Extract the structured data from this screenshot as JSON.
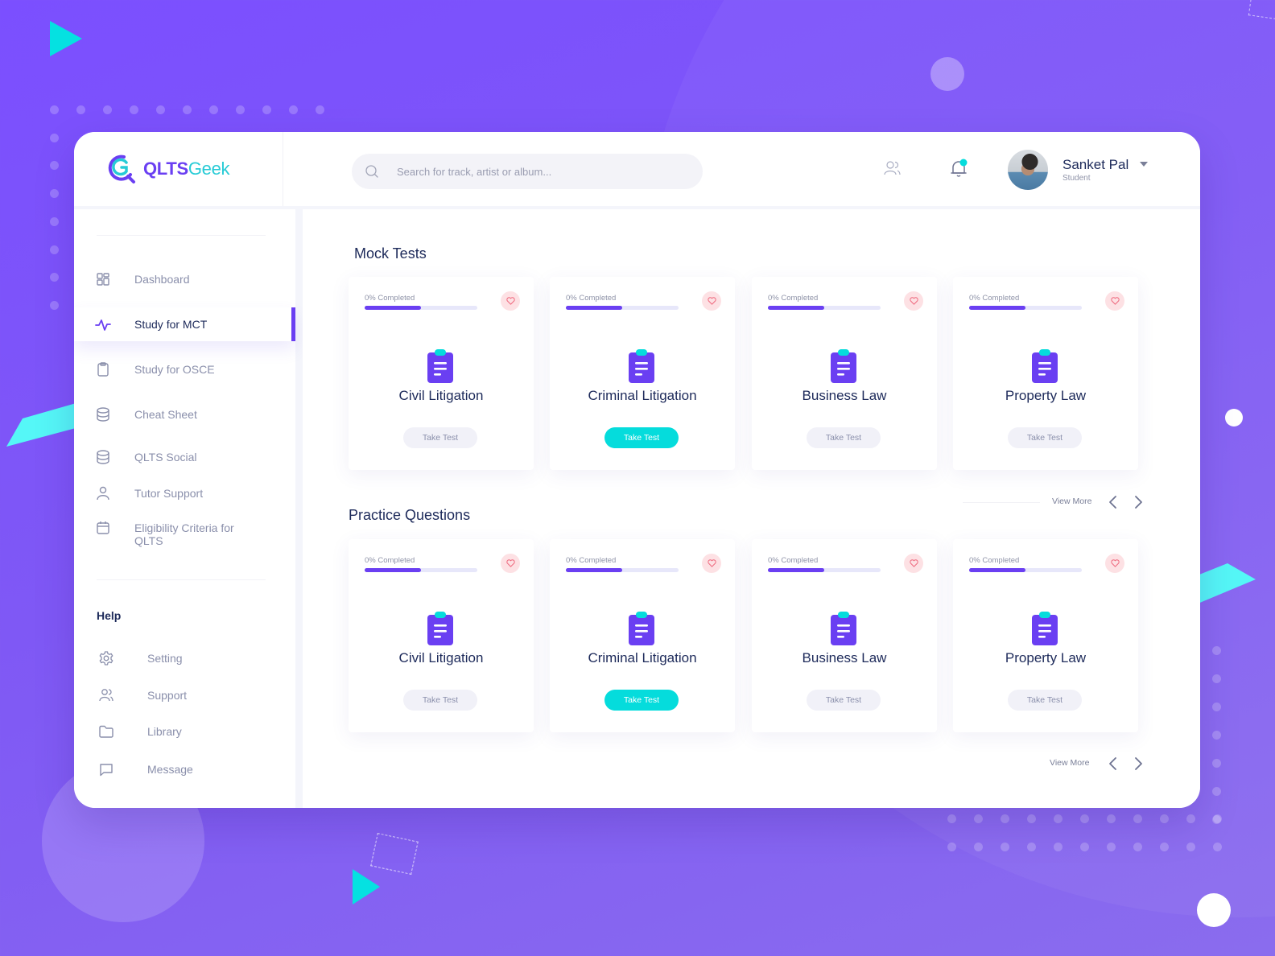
{
  "app": {
    "logo_q": "QLTS",
    "logo_g": "Geek"
  },
  "search": {
    "placeholder": "Search for track, artist or album..."
  },
  "user": {
    "name": "Sanket Pal",
    "role": "Student",
    "notification_dot_color": "#05dcdc"
  },
  "sidebar": {
    "items": [
      {
        "label": "Dashboard",
        "icon": "grid-icon"
      },
      {
        "label": "Study for MCT",
        "icon": "activity-icon",
        "active": true
      },
      {
        "label": "Study for OSCE",
        "icon": "clipboard-icon"
      },
      {
        "label": "Cheat Sheet",
        "icon": "database-icon"
      },
      {
        "label": "QLTS Social",
        "icon": "database-icon"
      },
      {
        "label": "Tutor Support",
        "icon": "user-icon"
      },
      {
        "label": "Eligibility Criteria for QLTS",
        "icon": "calendar-icon"
      }
    ],
    "help_title": "Help",
    "help_items": [
      {
        "label": "Setting",
        "icon": "gear-icon"
      },
      {
        "label": "Support",
        "icon": "users-icon"
      },
      {
        "label": "Library",
        "icon": "folder-icon"
      },
      {
        "label": "Message",
        "icon": "message-icon"
      }
    ]
  },
  "mock_tests": {
    "title": "Mock Tests",
    "cards": [
      {
        "name": "Civil Litigation",
        "progress_label": "0% Completed",
        "progress_bar": 0.5,
        "button": "Take Test",
        "highlight": false
      },
      {
        "name": "Criminal Litigation",
        "progress_label": "0% Completed",
        "progress_bar": 0.5,
        "button": "Take Test",
        "highlight": true
      },
      {
        "name": "Business Law",
        "progress_label": "0% Completed",
        "progress_bar": 0.5,
        "button": "Take Test",
        "highlight": false
      },
      {
        "name": "Property Law",
        "progress_label": "0% Completed",
        "progress_bar": 0.5,
        "button": "Take Test",
        "highlight": false
      }
    ],
    "view_more": "View More"
  },
  "practice_questions": {
    "title": "Practice Questions",
    "cards": [
      {
        "name": "Civil Litigation",
        "progress_label": "0% Completed",
        "progress_bar": 0.5,
        "button": "Take Test",
        "highlight": false
      },
      {
        "name": "Criminal Litigation",
        "progress_label": "0% Completed",
        "progress_bar": 0.5,
        "button": "Take Test",
        "highlight": true
      },
      {
        "name": "Business Law",
        "progress_label": "0% Completed",
        "progress_bar": 0.5,
        "button": "Take Test",
        "highlight": false
      },
      {
        "name": "Property Law",
        "progress_label": "0% Completed",
        "progress_bar": 0.5,
        "button": "Take Test",
        "highlight": false
      }
    ],
    "view_more": "View More"
  },
  "colors": {
    "brand_purple": "#6a3ff2",
    "brand_cyan": "#05dcdc",
    "text_dark": "#1d2a5a",
    "text_muted": "#8a8fab",
    "favorite_bg": "#fde1e4"
  }
}
